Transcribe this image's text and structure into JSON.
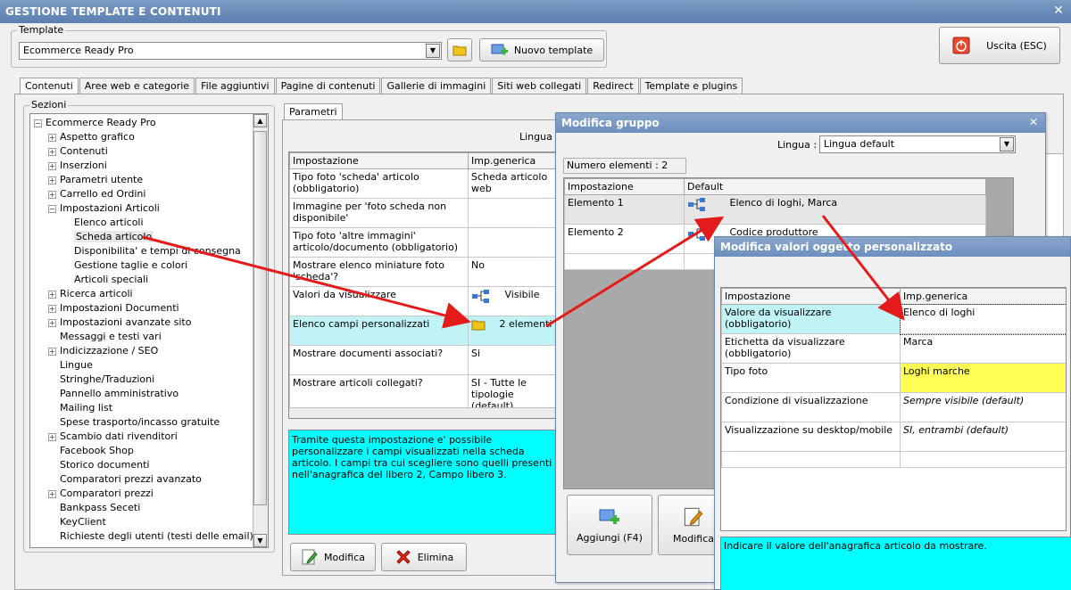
{
  "window": {
    "title": "GESTIONE TEMPLATE E CONTENUTI",
    "close_glyph": "✕"
  },
  "template_group": {
    "legend": "Template",
    "selected": "Ecommerce Ready Pro",
    "new_button": "Nuovo template",
    "exit_button": "Uscita (ESC)"
  },
  "tabs": [
    "Contenuti",
    "Aree web e categorie",
    "File aggiuntivi",
    "Pagine di contenuti",
    "Gallerie di immagini",
    "Siti web collegati",
    "Redirect",
    "Template e plugins"
  ],
  "sections": {
    "legend": "Sezioni",
    "items": [
      {
        "label": "Ecommerce Ready Pro",
        "level": 0,
        "exp": "minus"
      },
      {
        "label": "Aspetto grafico",
        "level": 1,
        "exp": "plus"
      },
      {
        "label": "Contenuti",
        "level": 1,
        "exp": "plus"
      },
      {
        "label": "Inserzioni",
        "level": 1,
        "exp": "plus"
      },
      {
        "label": "Parametri utente",
        "level": 1,
        "exp": "plus"
      },
      {
        "label": "Carrello ed Ordini",
        "level": 1,
        "exp": "plus"
      },
      {
        "label": "Impostazioni Articoli",
        "level": 1,
        "exp": "minus"
      },
      {
        "label": "Elenco articoli",
        "level": 2,
        "exp": ""
      },
      {
        "label": "Scheda articolo",
        "level": 2,
        "exp": "",
        "selected": true
      },
      {
        "label": "Disponibilita' e tempi di consegna",
        "level": 2,
        "exp": ""
      },
      {
        "label": "Gestione taglie e colori",
        "level": 2,
        "exp": ""
      },
      {
        "label": "Articoli speciali",
        "level": 2,
        "exp": ""
      },
      {
        "label": "Ricerca articoli",
        "level": 1,
        "exp": "plus"
      },
      {
        "label": "Impostazioni Documenti",
        "level": 1,
        "exp": "plus"
      },
      {
        "label": "Impostazioni avanzate sito",
        "level": 1,
        "exp": "plus"
      },
      {
        "label": "Messaggi e testi vari",
        "level": 1,
        "exp": ""
      },
      {
        "label": "Indicizzazione / SEO",
        "level": 1,
        "exp": "plus"
      },
      {
        "label": "Lingue",
        "level": 1,
        "exp": ""
      },
      {
        "label": "Stringhe/Traduzioni",
        "level": 1,
        "exp": ""
      },
      {
        "label": "Pannello amministrativo",
        "level": 1,
        "exp": ""
      },
      {
        "label": "Mailing list",
        "level": 1,
        "exp": ""
      },
      {
        "label": "Spese trasporto/incasso gratuite",
        "level": 1,
        "exp": ""
      },
      {
        "label": "Scambio dati rivenditori",
        "level": 1,
        "exp": "plus"
      },
      {
        "label": "Facebook Shop",
        "level": 1,
        "exp": ""
      },
      {
        "label": "Storico documenti",
        "level": 1,
        "exp": ""
      },
      {
        "label": "Comparatori prezzi avanzato",
        "level": 1,
        "exp": ""
      },
      {
        "label": "Comparatori prezzi",
        "level": 1,
        "exp": "plus"
      },
      {
        "label": "Bankpass Seceti",
        "level": 1,
        "exp": ""
      },
      {
        "label": "KeyClient",
        "level": 1,
        "exp": ""
      },
      {
        "label": "Richieste degli utenti (testi delle email)",
        "level": 1,
        "exp": ""
      }
    ]
  },
  "params": {
    "tab": "Parametri",
    "lingua_label": "Lingua :",
    "col_setting": "Impostazione",
    "col_value": "Imp.generica",
    "rows": [
      {
        "setting": "Tipo foto 'scheda' articolo (obbligatorio)",
        "value": "Scheda articolo web",
        "bold": true
      },
      {
        "setting": "Immagine per 'foto scheda non disponibile'",
        "value": ""
      },
      {
        "setting": "Tipo foto 'altre immagini' articolo/documento (obbligatorio)",
        "value": "",
        "bold": true
      },
      {
        "setting": "Mostrare elenco miniature foto 'scheda'?",
        "value": "No"
      },
      {
        "setting": "Valori da visualizzare",
        "value": "Visibile",
        "icon": "tree"
      },
      {
        "setting": "Elenco campi personalizzati",
        "value": "2 elementi",
        "icon": "folder",
        "highlight": true
      },
      {
        "setting": "Mostrare documenti associati?",
        "value": "Si"
      },
      {
        "setting": "Mostrare articoli collegati?",
        "value": "SI - Tutte le tipologie (default)"
      }
    ],
    "description": "Tramite questa impostazione e' possibile personalizzare i campi visualizzati nella scheda articolo. I campi tra cui scegliere sono quelli presenti nell'anagrafica del libero 2, Campo libero 3.",
    "btn_modifica": "Modifica",
    "btn_elimina": "Elimina"
  },
  "group_dialog": {
    "title": "Modifica gruppo",
    "lingua_label": "Lingua :",
    "lingua_value": "Lingua default",
    "count": "Numero elementi : 2",
    "col_setting": "Impostazione",
    "col_default": "Default",
    "rows": [
      {
        "setting": "Elemento 1",
        "value": "Elenco di loghi, Marca"
      },
      {
        "setting": "Elemento 2",
        "value": "Codice produttore"
      }
    ],
    "btn_add": "Aggiungi (F4)",
    "btn_edit": "Modifica"
  },
  "object_dialog": {
    "title": "Modifica valori oggetto personalizzato",
    "col_setting": "Impostazione",
    "col_value": "Imp.generica",
    "rows": [
      {
        "setting": "Valore da visualizzare (obbligatorio)",
        "value": "Elenco di loghi",
        "bold": true,
        "cyan": true
      },
      {
        "setting": "Etichetta da visualizzare (obbligatorio)",
        "value": "Marca",
        "bold": true
      },
      {
        "setting": "Tipo foto",
        "value": "Loghi marche",
        "yellow": true
      },
      {
        "setting": "Condizione di visualizzazione",
        "value": "Sempre visibile (default)",
        "italic": true
      },
      {
        "setting": "Visualizzazione su desktop/mobile",
        "value": "SI, entrambi (default)",
        "italic": true
      }
    ],
    "description": "Indicare il valore dell'anagrafica articolo da mostrare."
  },
  "colors": {
    "arrow": "#e41b1b",
    "cyan": "#00ffff",
    "yellow": "#ffff55",
    "title_blue": "#6d8ebd"
  }
}
